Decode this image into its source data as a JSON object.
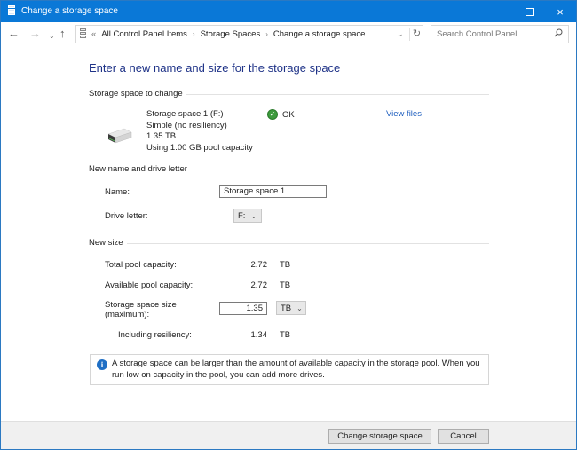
{
  "window": {
    "title": "Change a storage space",
    "controls": {
      "minimize": "minimize",
      "maximize": "maximize",
      "close": "×"
    }
  },
  "nav": {
    "back": "←",
    "forward": "→",
    "recent": "⌄",
    "up": "↑",
    "breadcrumb_prefix": "«",
    "breadcrumbs": [
      "All Control Panel Items",
      "Storage Spaces",
      "Change a storage space"
    ],
    "separator": "›",
    "dropdown": "⌄",
    "refresh": "↻",
    "search_placeholder": "Search Control Panel"
  },
  "main": {
    "heading": "Enter a new name and size for the storage space",
    "sections": {
      "storage_to_change": "Storage space to change",
      "name_and_letter": "New name and drive letter",
      "new_size": "New size"
    },
    "drive": {
      "name": "Storage space 1 (F:)",
      "resiliency": "Simple (no resiliency)",
      "size": "1.35 TB",
      "usage": "Using 1.00 GB pool capacity",
      "status": "OK",
      "view_files": "View files"
    },
    "name_row": {
      "label": "Name:",
      "value": "Storage space 1"
    },
    "drive_letter_row": {
      "label": "Drive letter:",
      "value": "F:"
    },
    "total_pool": {
      "label": "Total pool capacity:",
      "value": "2.72",
      "unit": "TB"
    },
    "available_pool": {
      "label": "Available pool capacity:",
      "value": "2.72",
      "unit": "TB"
    },
    "size_row": {
      "label_line1": "Storage space size",
      "label_line2": "(maximum):",
      "value": "1.35",
      "unit": "TB"
    },
    "including_resiliency": {
      "label": "Including resiliency:",
      "value": "1.34",
      "unit": "TB"
    },
    "info": "A storage space can be larger than the amount of available capacity in the storage pool. When you run low on capacity in the pool, you can add more drives."
  },
  "footer": {
    "change_button": "Change storage space",
    "cancel_button": "Cancel"
  },
  "colors": {
    "titlebar": "#0a78d7",
    "heading": "#1e3287",
    "link": "#1f5fbf",
    "ok": "#3c9a3c",
    "info": "#1f6fc5"
  }
}
